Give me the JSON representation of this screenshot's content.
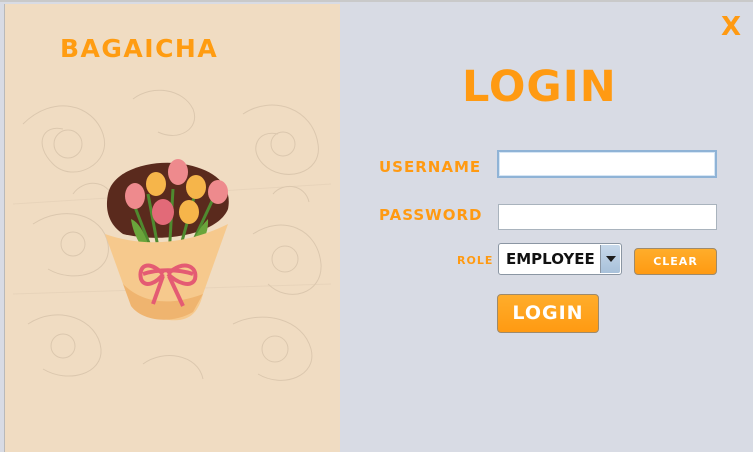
{
  "brand": {
    "name": "BAGAICHA"
  },
  "window": {
    "close_label": "X"
  },
  "form": {
    "title": "LOGIN",
    "username_label": "USERNAME",
    "username_value": "",
    "password_label": "PASSWORD",
    "password_value": "",
    "role_label": "ROLE",
    "role_value": "EMPLOYEE",
    "clear_label": "CLEAR",
    "login_label": "LOGIN"
  },
  "colors": {
    "accent": "#ff9a12",
    "left_panel": "#f0dcc2",
    "right_panel": "#d8dbe4"
  },
  "icons": {
    "illustration": "tulip-bouquet-illustration",
    "dropdown": "chevron-down-icon"
  }
}
